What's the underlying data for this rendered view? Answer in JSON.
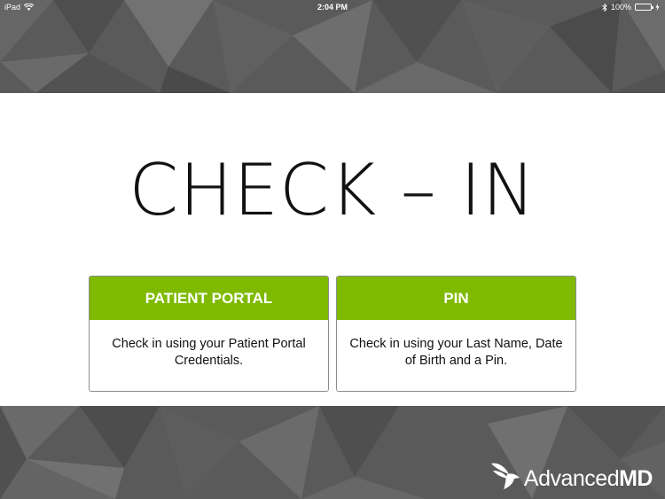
{
  "status_bar": {
    "device": "iPad",
    "time": "2:04 PM",
    "battery_percent": "100%",
    "battery_level": 1.0
  },
  "colors": {
    "accent_green": "#7fba00",
    "band_gray": "#5a5a5a"
  },
  "main": {
    "title": "CHECK – IN"
  },
  "cards": [
    {
      "header": "PATIENT PORTAL",
      "body_line1": "Check in using your Patient Portal",
      "body_line2": "Credentials."
    },
    {
      "header": "PIN",
      "body_line1": "Check in using your Last Name, Date",
      "body_line2": "of Birth and a Pin."
    }
  ],
  "footer": {
    "logo_regular": "Advanced",
    "logo_bold": "MD",
    "logo_icon": "hummingbird-icon"
  }
}
